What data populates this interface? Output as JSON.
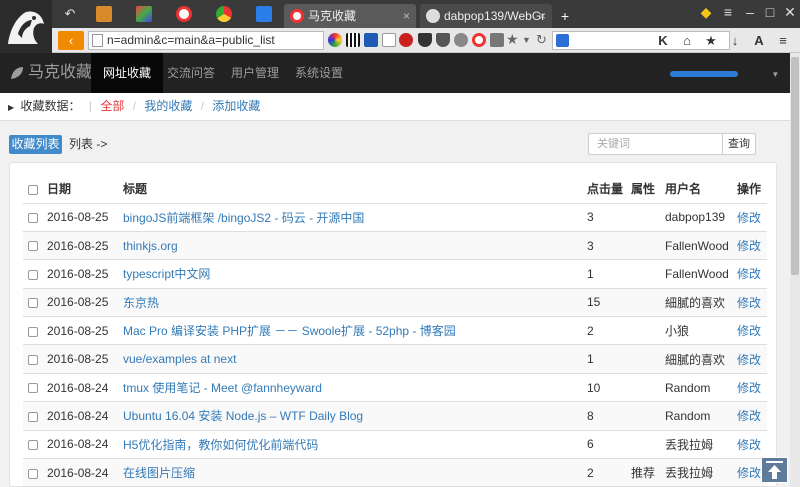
{
  "browser": {
    "tabs": [
      {
        "label": "马克收藏",
        "active": true
      },
      {
        "label": "dabpop139/WebGr",
        "active": false
      }
    ],
    "url": "n=admin&c=main&a=public_list",
    "new_tab_symbol": "+",
    "close_symbol": "×"
  },
  "navbar": {
    "brand": "马克收藏",
    "items": [
      {
        "label": "网址收藏",
        "active": true
      },
      {
        "label": "交流问答",
        "active": false
      },
      {
        "label": "用户管理",
        "active": false
      },
      {
        "label": "系统设置",
        "active": false
      }
    ]
  },
  "breadcrumb": {
    "title": "收藏数据：",
    "current": "全部",
    "links": [
      "我的收藏",
      "添加收藏"
    ]
  },
  "toolbar": {
    "list_button": "收藏列表",
    "list_label": "列表 ->",
    "search_placeholder": "关键词",
    "search_button": "查询"
  },
  "table": {
    "headers": {
      "date": "日期",
      "title": "标题",
      "clicks": "点击量",
      "attr": "属性",
      "user": "用户名",
      "action": "操作"
    },
    "rows": [
      {
        "date": "2016-08-25",
        "title": "bingoJS前端框架 /bingoJS2 - 码云 - 开源中国",
        "clicks": "3",
        "attr": "",
        "user": "dabpop139",
        "action": "修改"
      },
      {
        "date": "2016-08-25",
        "title": "thinkjs.org",
        "clicks": "3",
        "attr": "",
        "user": "FallenWood",
        "action": "修改"
      },
      {
        "date": "2016-08-25",
        "title": "typescript中文网",
        "clicks": "1",
        "attr": "",
        "user": "FallenWood",
        "action": "修改"
      },
      {
        "date": "2016-08-25",
        "title": "东京热",
        "clicks": "15",
        "attr": "",
        "user": "細膩的喜欢",
        "action": "修改"
      },
      {
        "date": "2016-08-25",
        "title": "Mac Pro 编译安装 PHP扩展 －－ Swoole扩展 - 52php - 博客园",
        "clicks": "2",
        "attr": "",
        "user": "小狼",
        "action": "修改"
      },
      {
        "date": "2016-08-25",
        "title": "vue/examples at next",
        "clicks": "1",
        "attr": "",
        "user": "細膩的喜欢",
        "action": "修改"
      },
      {
        "date": "2016-08-24",
        "title": "tmux 使用笔记 - Meet @fannheyward",
        "clicks": "10",
        "attr": "",
        "user": "Random",
        "action": "修改"
      },
      {
        "date": "2016-08-24",
        "title": "Ubuntu 16.04 安装 Node.js – WTF Daily Blog",
        "clicks": "8",
        "attr": "",
        "user": "Random",
        "action": "修改"
      },
      {
        "date": "2016-08-24",
        "title": "H5优化指南，教你如何优化前端代码",
        "clicks": "6",
        "attr": "",
        "user": "丢我拉姆",
        "action": "修改"
      },
      {
        "date": "2016-08-24",
        "title": "在线图片压缩",
        "clicks": "2",
        "attr": "推荐",
        "user": "丢我拉姆",
        "action": "修改"
      }
    ]
  }
}
